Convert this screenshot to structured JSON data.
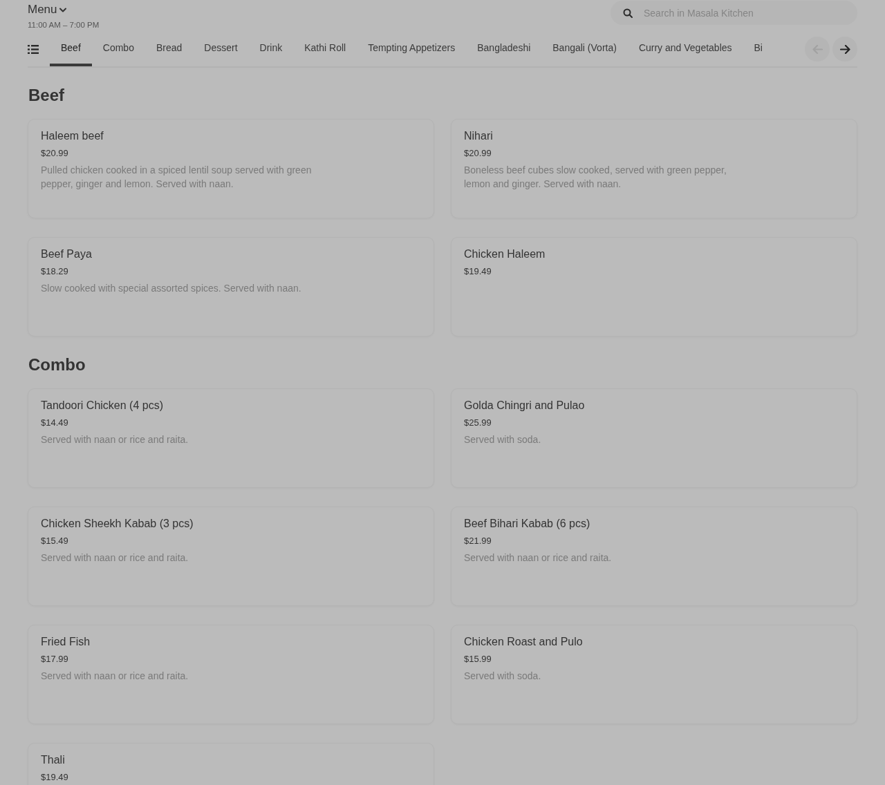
{
  "header": {
    "title": "Menu",
    "hours": "11:00 AM – 7:00 PM"
  },
  "search": {
    "placeholder": "Search in Masala Kitchen"
  },
  "tabs": [
    {
      "label": "Beef",
      "selected": true
    },
    {
      "label": "Combo",
      "selected": false
    },
    {
      "label": "Bread",
      "selected": false
    },
    {
      "label": "Dessert",
      "selected": false
    },
    {
      "label": "Drink",
      "selected": false
    },
    {
      "label": "Kathi Roll",
      "selected": false
    },
    {
      "label": "Tempting Appetizers",
      "selected": false
    },
    {
      "label": "Bangladeshi",
      "selected": false
    },
    {
      "label": "Bangali (Vorta)",
      "selected": false
    },
    {
      "label": "Curry and Vegetables",
      "selected": false
    },
    {
      "label": "Bi",
      "selected": false
    }
  ],
  "scroll_buttons": [
    {
      "kind": "previous",
      "disabled": true
    },
    {
      "kind": "next",
      "disabled": false
    }
  ],
  "sections": [
    {
      "title": "Beef",
      "items": [
        {
          "name": "Haleem beef",
          "price": "$20.99",
          "description": "Pulled chicken cooked in a spiced lentil soup served with green pepper, ginger and lemon. Served with naan."
        },
        {
          "name": "Nihari",
          "price": "$20.99",
          "description": "Boneless beef cubes slow cooked, served with green pepper, lemon and ginger. Served with naan."
        },
        {
          "name": "Beef Paya",
          "price": "$18.29",
          "description": "Slow cooked with special assorted spices. Served with naan."
        },
        {
          "name": "Chicken Haleem",
          "price": "$19.49"
        }
      ]
    },
    {
      "title": "Combo",
      "items": [
        {
          "name": "Tandoori Chicken (4 pcs)",
          "price": "$14.49",
          "description": "Served with naan or rice and raita."
        },
        {
          "name": "Golda Chingri and Pulao",
          "price": "$25.99",
          "description": "Served with soda."
        },
        {
          "name": "Chicken Sheekh Kabab (3 pcs)",
          "price": "$15.49",
          "description": "Served with naan or rice and raita."
        },
        {
          "name": "Beef Bihari Kabab (6 pcs)",
          "price": "$21.99",
          "description": "Served with naan or rice and raita."
        },
        {
          "name": "Fried Fish",
          "price": "$17.99",
          "description": "Served with naan or rice and raita."
        },
        {
          "name": "Chicken Roast and Pulo",
          "price": "$15.99",
          "description": "Served with soda."
        },
        {
          "name": "Thali",
          "price": "$19.49"
        }
      ]
    }
  ]
}
